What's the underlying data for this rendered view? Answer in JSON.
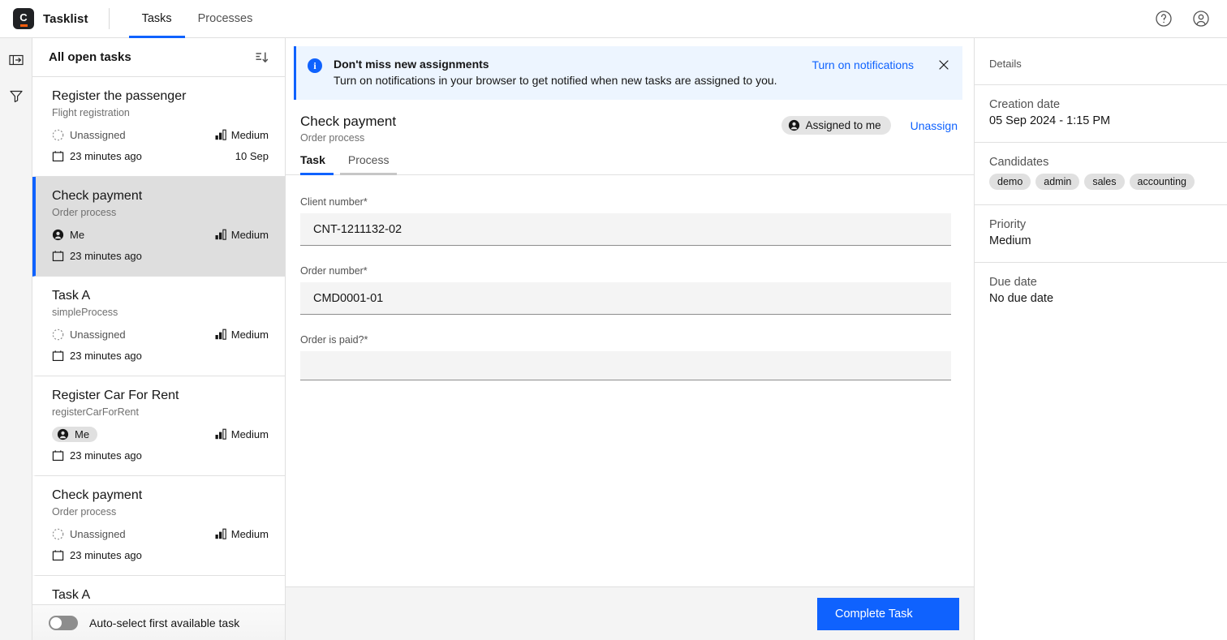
{
  "app": {
    "brand_name": "Tasklist",
    "logo_letter": "C",
    "nav": [
      {
        "label": "Tasks",
        "active": true
      },
      {
        "label": "Processes",
        "active": false
      }
    ],
    "top_right_icons": [
      "help-icon",
      "user-avatar-icon"
    ]
  },
  "rail": {
    "items": [
      {
        "icon": "expand-panel-icon"
      },
      {
        "icon": "filter-icon"
      }
    ]
  },
  "tasklist": {
    "header_title": "All open tasks",
    "sort_icon": "sort-descending-icon",
    "footer": {
      "toggle_label": "Auto-select first available task",
      "toggle_on": false
    },
    "items": [
      {
        "name": "Register the passenger",
        "process": "Flight registration",
        "assignee": "Unassigned",
        "assignee_type": "unassigned",
        "priority": "Medium",
        "date": "23 minutes ago",
        "due": "10 Sep",
        "selected": false
      },
      {
        "name": "Check payment",
        "process": "Order process",
        "assignee": "Me",
        "assignee_type": "me-plain",
        "priority": "Medium",
        "date": "23 minutes ago",
        "due": "",
        "selected": true
      },
      {
        "name": "Task A",
        "process": "simpleProcess",
        "assignee": "Unassigned",
        "assignee_type": "unassigned",
        "priority": "Medium",
        "date": "23 minutes ago",
        "due": "",
        "selected": false
      },
      {
        "name": "Register Car For Rent",
        "process": "registerCarForRent",
        "assignee": "Me",
        "assignee_type": "me-chip",
        "priority": "Medium",
        "date": "23 minutes ago",
        "due": "",
        "selected": false
      },
      {
        "name": "Check payment",
        "process": "Order process",
        "assignee": "Unassigned",
        "assignee_type": "unassigned",
        "priority": "Medium",
        "date": "23 minutes ago",
        "due": "",
        "selected": false
      },
      {
        "name": "Task A",
        "process": "",
        "assignee": "",
        "assignee_type": "none",
        "priority": "",
        "date": "",
        "due": "",
        "selected": false
      }
    ]
  },
  "banner": {
    "icon": "info-icon",
    "title": "Don't miss new assignments",
    "description": "Turn on notifications in your browser to get notified when new tasks are assigned to you.",
    "action_label": "Turn on notifications",
    "close_icon": "close-icon"
  },
  "task_header": {
    "name": "Check payment",
    "process": "Order process",
    "assigned_chip": "Assigned to me",
    "assigned_icon": "user-filled-icon",
    "unassign_label": "Unassign"
  },
  "tabs": [
    {
      "label": "Task",
      "active": true
    },
    {
      "label": "Process",
      "active": false
    }
  ],
  "form": {
    "fields": [
      {
        "label": "Client number*",
        "value": "CNT-1211132-02"
      },
      {
        "label": "Order number*",
        "value": "CMD0001-01"
      },
      {
        "label": "Order is paid?*",
        "value": ""
      }
    ]
  },
  "footer": {
    "complete_label": "Complete Task"
  },
  "details": {
    "title": "Details",
    "blocks": [
      {
        "label": "Creation date",
        "value": "05 Sep 2024 - 1:15 PM",
        "chips": []
      },
      {
        "label": "Candidates",
        "value": "",
        "chips": [
          "demo",
          "admin",
          "sales",
          "accounting"
        ]
      },
      {
        "label": "Priority",
        "value": "Medium",
        "chips": []
      },
      {
        "label": "Due date",
        "value": "No due date",
        "chips": []
      }
    ]
  },
  "colors": {
    "accent": "#0f62fe",
    "brand_orange": "#fc5d0d",
    "banner_bg": "#edf5ff",
    "selected_row": "#dedede",
    "field_bg": "#f4f4f4"
  }
}
